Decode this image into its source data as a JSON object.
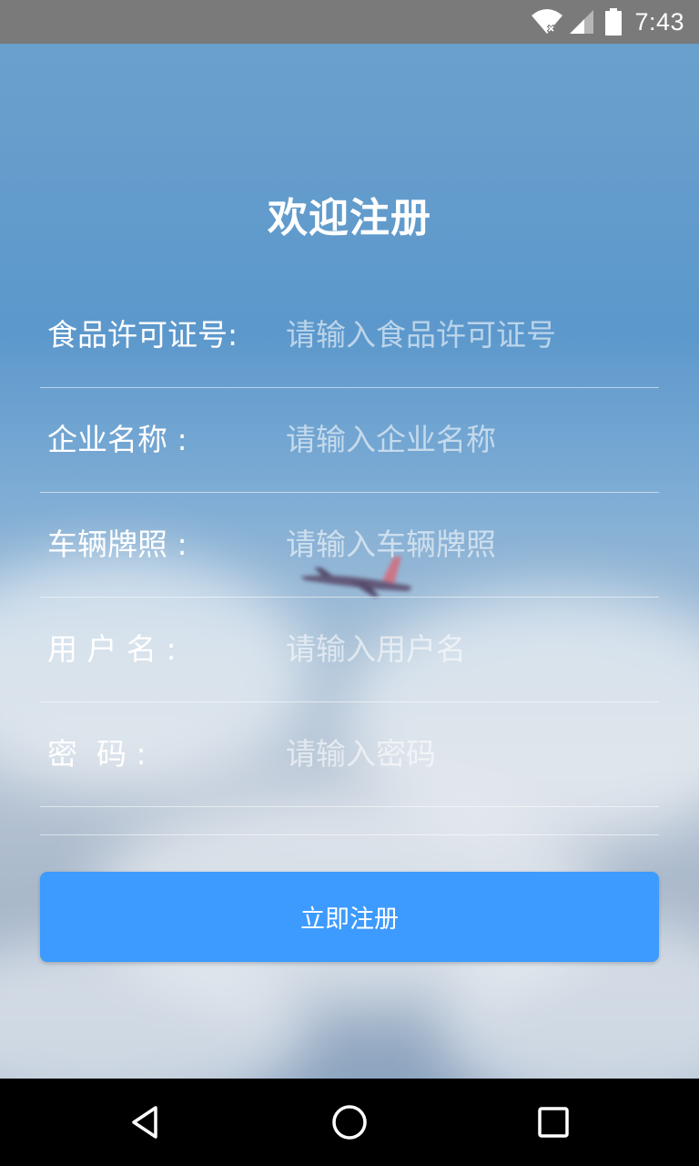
{
  "status_bar": {
    "time": "7:43",
    "icons": [
      "wifi-no-data-icon",
      "cellular-signal-icon",
      "battery-icon"
    ]
  },
  "page": {
    "title": "欢迎注册"
  },
  "form": {
    "fields": [
      {
        "label": "食品许可证号:",
        "placeholder": "请输入食品许可证号",
        "value": ""
      },
      {
        "label": "企业名称 :",
        "placeholder": "请输入企业名称",
        "value": ""
      },
      {
        "label": "车辆牌照 :",
        "placeholder": "请输入车辆牌照",
        "value": ""
      },
      {
        "label": "用 户 名 :",
        "placeholder": "请输入用户名",
        "value": ""
      },
      {
        "label": "密  码 :",
        "placeholder": "请输入密码",
        "value": ""
      }
    ],
    "submit_label": "立即注册"
  },
  "nav_bar": {
    "icons": [
      "back-triangle-icon",
      "home-circle-icon",
      "recents-square-icon"
    ]
  },
  "colors": {
    "status_bar": "#7a7a7a",
    "button": "#3d9bff",
    "text": "#ffffff",
    "nav_bar": "#000000"
  }
}
